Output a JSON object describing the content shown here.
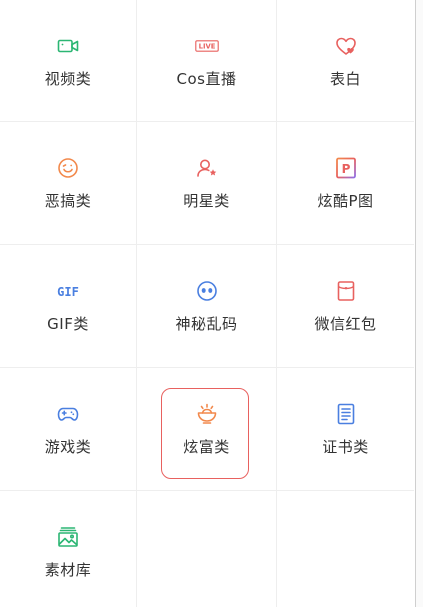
{
  "categories": [
    {
      "label": "视频类",
      "icon": "video-camera-icon"
    },
    {
      "label": "Cos直播",
      "icon": "live-badge-icon"
    },
    {
      "label": "表白",
      "icon": "heart-outline-icon"
    },
    {
      "label": "恶搞类",
      "icon": "wink-face-icon"
    },
    {
      "label": "明星类",
      "icon": "user-star-icon"
    },
    {
      "label": "炫酷P图",
      "icon": "p-square-icon"
    },
    {
      "label": "GIF类",
      "icon": "gif-icon"
    },
    {
      "label": "神秘乱码",
      "icon": "alien-face-icon"
    },
    {
      "label": "微信红包",
      "icon": "red-packet-icon"
    },
    {
      "label": "游戏类",
      "icon": "gamepad-icon"
    },
    {
      "label": "炫富类",
      "icon": "bowl-icon"
    },
    {
      "label": "证书类",
      "icon": "certificate-icon"
    },
    {
      "label": "素材库",
      "icon": "image-library-icon"
    }
  ],
  "live_badge_text": "LIVE",
  "gif_icon_text": "GIF",
  "p_icon_text": "P",
  "selected_index": 10,
  "colors": {
    "green": "#2bb673",
    "red": "#e8615f",
    "orange": "#f2894c",
    "blue": "#4a7fe0",
    "text": "#333333",
    "divider": "#eeeeee"
  }
}
